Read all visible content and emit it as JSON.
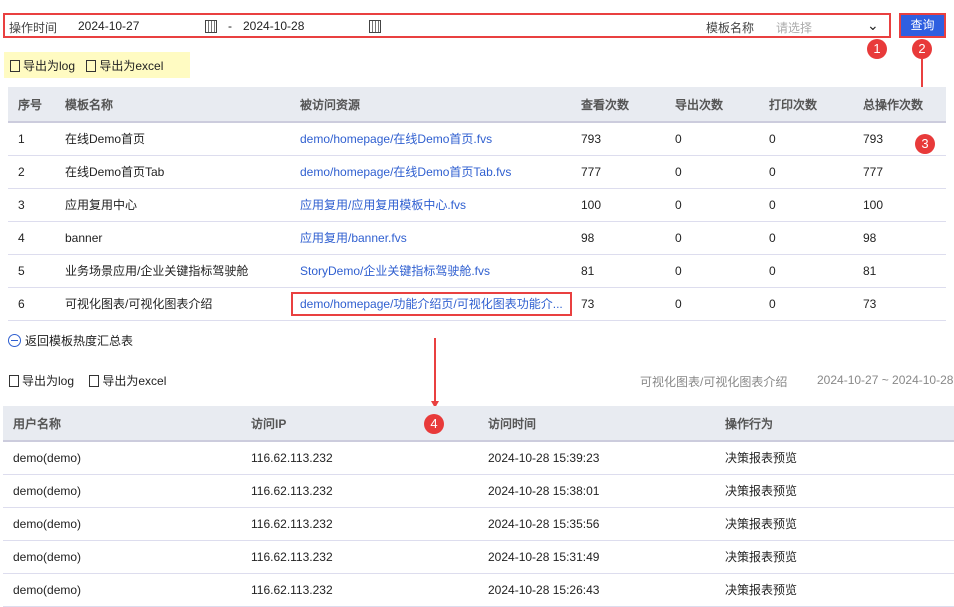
{
  "filter": {
    "time_label": "操作时间",
    "start_date": "2024-10-27",
    "separator": "-",
    "end_date": "2024-10-28",
    "template_label": "模板名称",
    "template_placeholder": "请选择",
    "query_button": "查询"
  },
  "annotations": [
    "1",
    "2",
    "3",
    "4"
  ],
  "export1": {
    "log": "导出为log",
    "excel": "导出为excel"
  },
  "table1": {
    "headers": [
      "序号",
      "模板名称",
      "被访问资源",
      "查看次数",
      "导出次数",
      "打印次数",
      "总操作次数"
    ],
    "rows": [
      [
        "1",
        "在线Demo首页",
        "demo/homepage/在线Demo首页.fvs",
        "793",
        "0",
        "0",
        "793"
      ],
      [
        "2",
        "在线Demo首页Tab",
        "demo/homepage/在线Demo首页Tab.fvs",
        "777",
        "0",
        "0",
        "777"
      ],
      [
        "3",
        "应用复用中心",
        "应用复用/应用复用模板中心.fvs",
        "100",
        "0",
        "0",
        "100"
      ],
      [
        "4",
        "banner",
        "应用复用/banner.fvs",
        "98",
        "0",
        "0",
        "98"
      ],
      [
        "5",
        "业务场景应用/企业关键指标驾驶舱",
        "StoryDemo/企业关键指标驾驶舱.fvs",
        "81",
        "0",
        "0",
        "81"
      ],
      [
        "6",
        "可视化图表/可视化图表介绍",
        "demo/homepage/功能介绍页/可视化图表功能介...",
        "73",
        "0",
        "0",
        "73"
      ]
    ]
  },
  "back_link": "返回模板热度汇总表",
  "export2": {
    "log": "导出为log",
    "excel": "导出为excel",
    "template": "可视化图表/可视化图表介绍",
    "range": "2024-10-27 ~ 2024-10-28"
  },
  "table2": {
    "headers": [
      "用户名称",
      "访问IP",
      "访问时间",
      "操作行为"
    ],
    "rows": [
      [
        "demo(demo)",
        "116.62.113.232",
        "2024-10-28 15:39:23",
        "决策报表预览"
      ],
      [
        "demo(demo)",
        "116.62.113.232",
        "2024-10-28 15:38:01",
        "决策报表预览"
      ],
      [
        "demo(demo)",
        "116.62.113.232",
        "2024-10-28 15:35:56",
        "决策报表预览"
      ],
      [
        "demo(demo)",
        "116.62.113.232",
        "2024-10-28 15:31:49",
        "决策报表预览"
      ],
      [
        "demo(demo)",
        "116.62.113.232",
        "2024-10-28 15:26:43",
        "决策报表预览"
      ]
    ]
  }
}
